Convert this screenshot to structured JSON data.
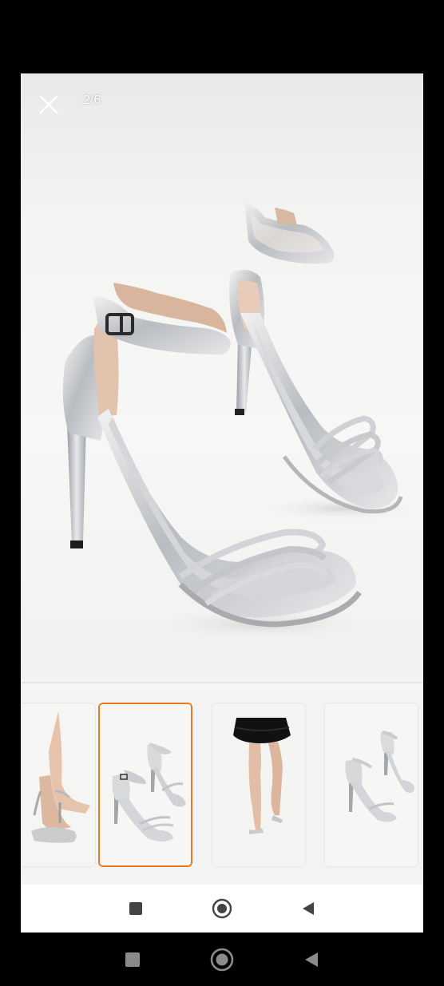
{
  "viewer": {
    "counter": "2/6",
    "current_index": 2,
    "total": 6
  },
  "icons": {
    "close": "close-icon",
    "inner_nav": [
      "recent-apps-icon",
      "home-icon",
      "back-icon"
    ],
    "system_nav": [
      "recent-apps-icon",
      "home-icon",
      "back-icon"
    ]
  },
  "colors": {
    "selected_border": "#ea7a20",
    "background": "#f5f5f5"
  },
  "thumbnails": [
    {
      "subject": "sandal-on-feet-side"
    },
    {
      "subject": "sandal-pair-studio",
      "selected": true
    },
    {
      "subject": "model-black-dress"
    },
    {
      "subject": "sandal-pair-angle"
    }
  ]
}
